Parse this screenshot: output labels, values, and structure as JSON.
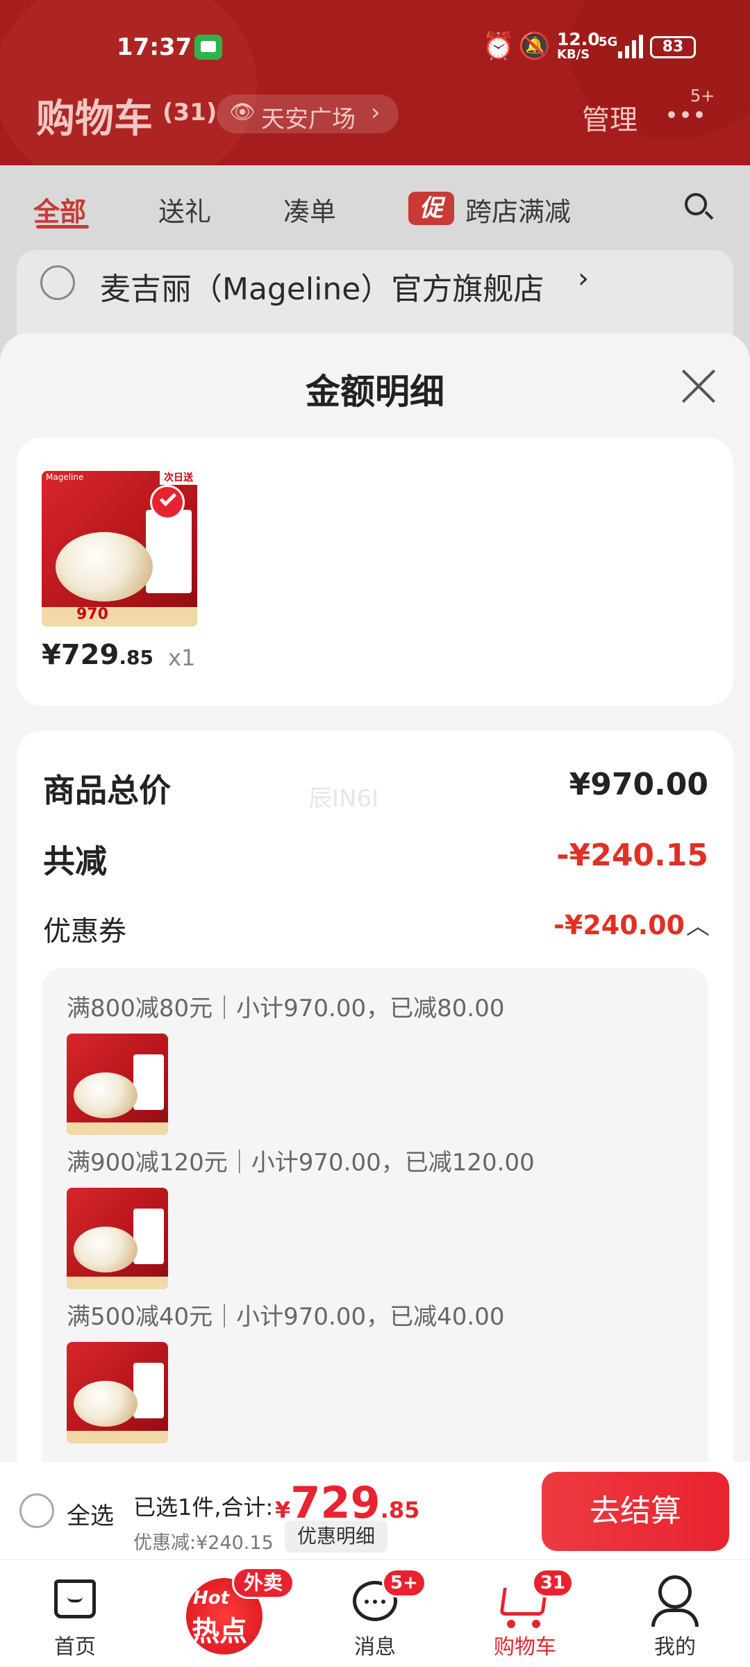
{
  "status_bar": {
    "time": "17:37",
    "net_speed_value": "12.0",
    "net_speed_unit": "KB/S",
    "network": "5G",
    "battery": "83"
  },
  "header": {
    "title": "购物车",
    "count": "(31)",
    "location": "天安广场",
    "manage": "管理",
    "more_badge": "5+"
  },
  "tabs": [
    {
      "label": "全部"
    },
    {
      "label": "送礼"
    },
    {
      "label": "凑单"
    },
    {
      "label": "跨店满减",
      "tag": "促"
    }
  ],
  "store": {
    "name": "麦吉丽（Mageline）官方旗舰店"
  },
  "sheet": {
    "title": "金额明细",
    "product": {
      "price_main": "¥729",
      "price_decimal": ".85",
      "qty": "x1",
      "thumb_badge": "次日送达",
      "thumb_price": "970",
      "thumb_brand": "Mageline"
    },
    "summary": {
      "total_label": "商品总价",
      "total_value": "¥970.00",
      "discount_label": "共减",
      "discount_value": "-¥240.15",
      "coupon_label": "优惠券",
      "coupon_value": "-¥240.00"
    },
    "watermark": "辰IN6I",
    "coupons": [
      {
        "text": "满800减80元｜小计970.00，已减80.00"
      },
      {
        "text": "满900减120元｜小计970.00，已减120.00"
      },
      {
        "text": "满500减40元｜小计970.00，已减40.00"
      }
    ]
  },
  "checkout": {
    "select_all": "全选",
    "selected_text": "已选1件,合计:",
    "currency": "¥",
    "total_main": "729",
    "total_decimal": ".85",
    "discount_text": "优惠减:¥240.15",
    "detail_button": "优惠明细",
    "checkout_button": "去结算"
  },
  "nav": [
    {
      "label": "首页",
      "icon": "home-icon"
    },
    {
      "label": "",
      "icon": "hot-icon",
      "badge": "外卖",
      "hot_en": "Hot",
      "hot_cn": "热点"
    },
    {
      "label": "消息",
      "icon": "message-icon",
      "badge": "5+"
    },
    {
      "label": "购物车",
      "icon": "cart-icon",
      "badge": "31"
    },
    {
      "label": "我的",
      "icon": "profile-icon"
    }
  ],
  "colors": {
    "brand_red": "#e8232f",
    "header_red": "#a51d1c",
    "price_red": "#e03024"
  }
}
